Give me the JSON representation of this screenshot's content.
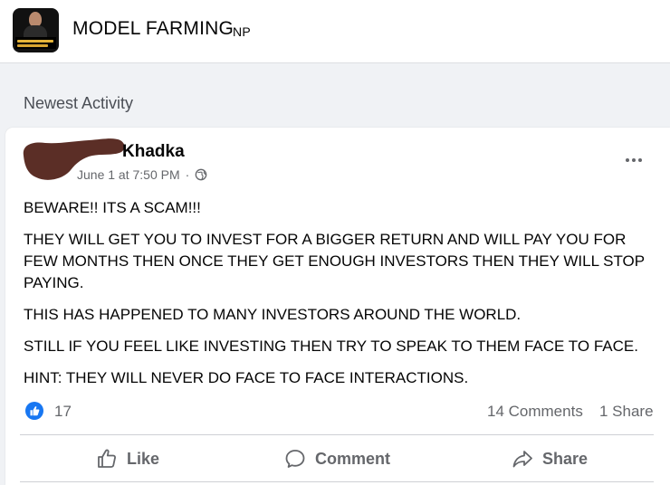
{
  "header": {
    "page_name": "MODEL FARMING",
    "page_suffix": "NP",
    "avatar_icon": "page-profile-picture"
  },
  "section": {
    "title": "Newest Activity"
  },
  "post": {
    "author_name": "Khadka",
    "timestamp": "June 1 at 7:50 PM",
    "separator": "·",
    "privacy_icon": "globe-icon",
    "body": [
      "BEWARE!! ITS A SCAM!!!",
      "THEY WILL GET YOU TO INVEST FOR A BIGGER RETURN AND WILL PAY YOU FOR FEW MONTHS THEN ONCE THEY GET ENOUGH INVESTORS THEN THEY WILL STOP PAYING.",
      "THIS HAS HAPPENED TO MANY INVESTORS AROUND THE WORLD.",
      "STILL IF YOU FEEL LIKE INVESTING THEN TRY TO SPEAK TO THEM FACE TO FACE.",
      "HINT: THEY WILL NEVER DO FACE TO FACE INTERACTIONS."
    ],
    "reactions": {
      "like_count": "17",
      "comments": "14 Comments",
      "shares": "1 Share"
    },
    "actions": {
      "like": "Like",
      "comment": "Comment",
      "share": "Share"
    }
  },
  "colors": {
    "brand_blue": "#1877f2",
    "secondary_text": "#65676b",
    "redaction_blob": "#5b2e26"
  }
}
